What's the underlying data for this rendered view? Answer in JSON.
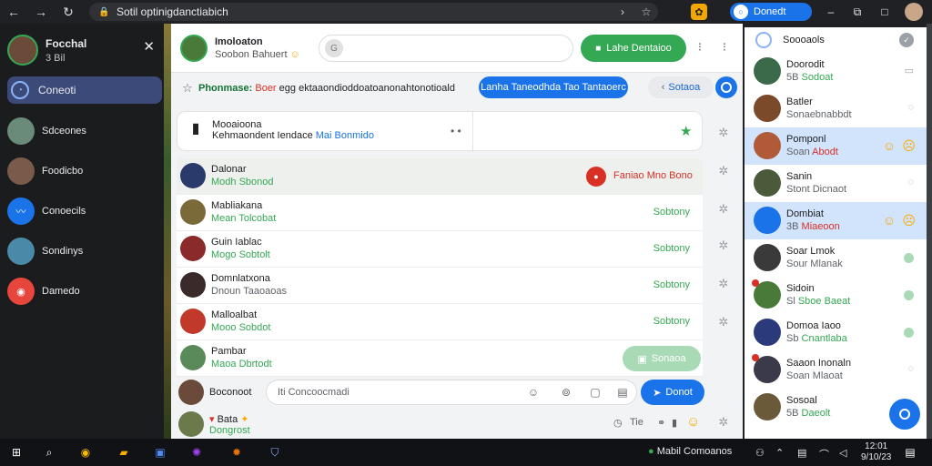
{
  "browser": {
    "url": "Sotil optinigdanctiabich",
    "profile_label": "Donedt"
  },
  "drawer": {
    "user_name": "Focchal",
    "user_sub": "3 Bil",
    "active_item": "Coneoti",
    "items": [
      "Sdceones",
      "Foodicbo",
      "Conoecils",
      "Sondinys",
      "Damedo"
    ]
  },
  "header": {
    "title": "Imoloaton",
    "subtitle": "Soobon Bahuert",
    "action_label": "Lahe Dentaioo"
  },
  "filter_bar": {
    "key": "Phonmase:",
    "accent": "Boer",
    "rest": "egg ektaaondioddoatoanonahtonotioald",
    "chip_primary": "Lanha Taneodhda Tao Tantaoerc",
    "chip_secondary": "Sotaoa"
  },
  "pinned": {
    "line1": "Mooaioona",
    "line2_main": "Kehmaondent Iendace",
    "line2_accent": "Mai Bonmido"
  },
  "conversations": [
    {
      "name": "Dalonar",
      "status": "Modh Sbonod",
      "right": "Faniao Mno Bono"
    },
    {
      "name": "Mabliakana",
      "status": "Mean Tolcobat",
      "right": "Sobtony"
    },
    {
      "name": "Guin Iablac",
      "status": "Mogo Sobtolt",
      "right": "Sobtony"
    },
    {
      "name": "Domnlatxona",
      "status": "Dnoun Taaoaoas",
      "right": "Sobtony"
    },
    {
      "name": "Malloalbat",
      "status": "Mooo Sobdot",
      "right": "Sobtony"
    },
    {
      "name": "Pambar",
      "status": "Maoa Dbrtodt",
      "right": "Sonaoa"
    }
  ],
  "composer": {
    "label": "Boconoot",
    "placeholder": "Iti Concoocmadi",
    "send_label": "Donot"
  },
  "bottom_row": {
    "line1": "Bata",
    "line2": "Dongrost",
    "meta": "Tie"
  },
  "right_panel": {
    "header": "Soooaols",
    "contacts": [
      {
        "name": "Doorodit",
        "status": "Sodoat",
        "status_prefix": "5B"
      },
      {
        "name": "Batler",
        "status": "Sonaebnabbdt",
        "status_prefix": ""
      },
      {
        "name": "Pomponl",
        "status": "Abodt",
        "status_prefix": "Soan"
      },
      {
        "name": "Sanin",
        "status": "Stont Dicnaot",
        "status_prefix": ""
      },
      {
        "name": "Dombiat",
        "status": "Miaeoon",
        "status_prefix": "3B"
      },
      {
        "name": "Soar Lmok",
        "status": "Sour Mlanak",
        "status_prefix": ""
      },
      {
        "name": "Sidoin",
        "status": "Sboe Baeat",
        "status_prefix": "Sl"
      },
      {
        "name": "Domoa Iaoo",
        "status": "Cnantlaba",
        "status_prefix": "Sb"
      },
      {
        "name": "Saaon Inonaln",
        "status": "Soan Mlaoat",
        "status_prefix": ""
      },
      {
        "name": "Sosoal",
        "status": "Daeolt",
        "status_prefix": "5B"
      }
    ]
  },
  "taskbar": {
    "app_label": "Mabil Comoanos",
    "clock_time": "12:01",
    "clock_date": "9/10/23"
  }
}
